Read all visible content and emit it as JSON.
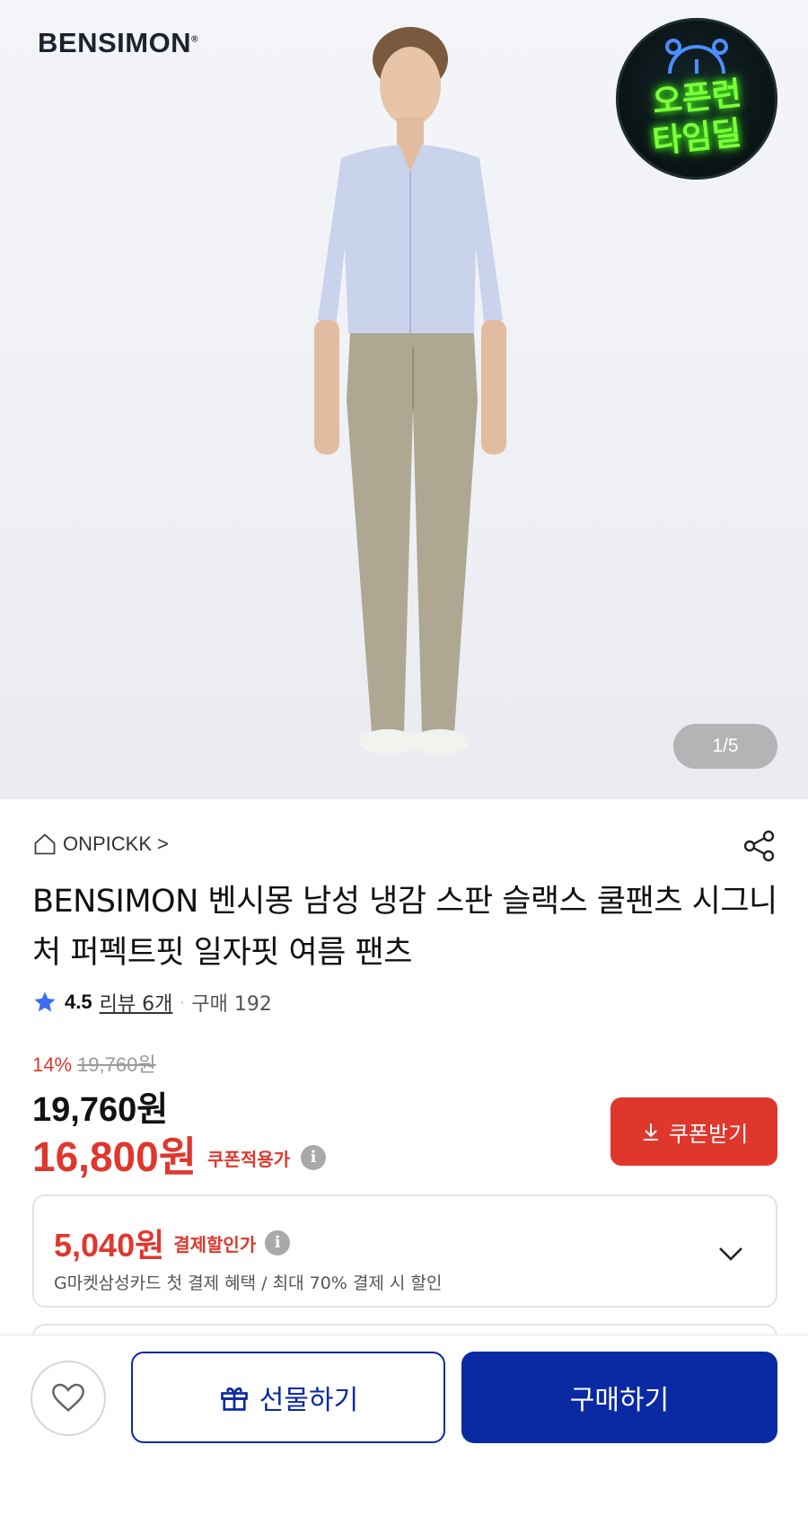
{
  "hero": {
    "brand_logo": "BENSIMON",
    "deal_badge_line1": "오픈런",
    "deal_badge_line2": "타임딜",
    "image_counter": "1/5"
  },
  "shop": {
    "name": "ONPICKK",
    "arrow": ">"
  },
  "product": {
    "title": "BENSIMON 벤시몽 남성 냉감 스판 슬랙스 쿨팬츠 시그니처 퍼펙트핏 일자핏 여름 팬츠"
  },
  "rating": {
    "score": "4.5",
    "reviews": "리뷰 6개",
    "separator": "·",
    "purchases": "구매 192"
  },
  "pricing": {
    "discount_rate": "14%",
    "original_price": "19,760원",
    "price": "19,760원",
    "coupon_price": "16,800원",
    "coupon_label": "쿠폰적용가",
    "info_glyph": "i",
    "coupon_button": "쿠폰받기"
  },
  "payment_discount": {
    "amount": "5,040원",
    "label": "결제할인가",
    "info_glyph": "i",
    "description": "G마켓삼성카드 첫 결제 혜택 / 최대 70% 결제 시 할인"
  },
  "bottom_bar": {
    "gift_button": "선물하기",
    "buy_button": "구매하기"
  },
  "colors": {
    "accent_red": "#e0372d",
    "brand_blue": "#0a2aa4",
    "badge_neon": "#7dff3a"
  },
  "icons": [
    "home-icon",
    "share-icon",
    "star-icon",
    "info-icon",
    "download-icon",
    "chevron-down-icon",
    "heart-icon",
    "gift-icon",
    "alarm-clock-icon"
  ]
}
